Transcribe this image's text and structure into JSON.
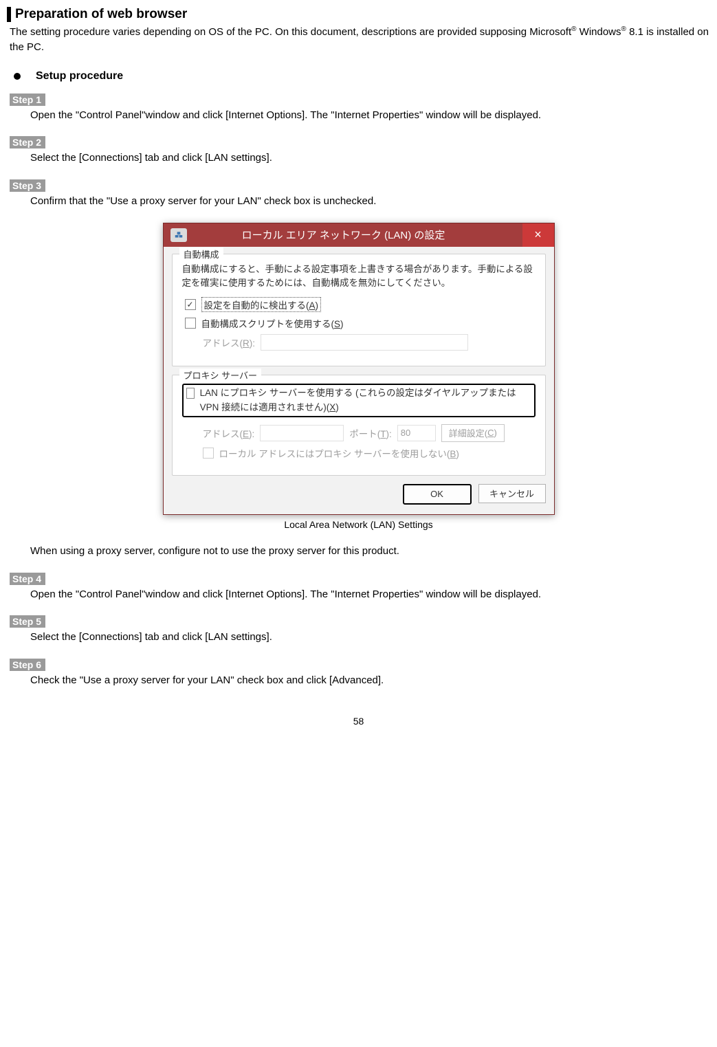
{
  "section": {
    "title": "Preparation of web browser",
    "intro_a": "The setting procedure varies depending on OS of the PC. On this document, descriptions are provided supposing Microsoft",
    "intro_b": " Windows",
    "intro_c": " 8.1 is installed on the PC.",
    "reg": "®"
  },
  "subhead": "Setup procedure",
  "steps": {
    "s1": {
      "tag": "Step 1",
      "body": "Open the \"Control Panel\"window and click [Internet Options]. The \"Internet Properties\" window will be displayed."
    },
    "s2": {
      "tag": "Step 2",
      "body": "Select the [Connections] tab and click [LAN settings]."
    },
    "s3": {
      "tag": "Step 3",
      "body": "Confirm that the \"Use a proxy server for your LAN\" check box is unchecked."
    },
    "s3b": "When using a proxy server, configure not to use the proxy server for this product.",
    "s4": {
      "tag": "Step 4",
      "body": "Open the \"Control Panel\"window and click [Internet Options]. The \"Internet Properties\" window will be displayed."
    },
    "s5": {
      "tag": "Step 5",
      "body": "Select the [Connections] tab and click [LAN settings]."
    },
    "s6": {
      "tag": "Step 6",
      "body": "Check the \"Use a proxy server for your LAN\" check box and click [Advanced]."
    }
  },
  "dialog": {
    "title": "ローカル エリア ネットワーク (LAN) の設定",
    "group_auto": "自動構成",
    "auto_desc": "自動構成にすると、手動による設定事項を上書きする場合があります。手動による設定を確実に使用するためには、自動構成を無効にしてください。",
    "auto_detect_pre": "設定を自動的に検出する(",
    "auto_detect_u": "A",
    "auto_detect_post": ")",
    "auto_script_pre": "自動構成スクリプトを使用する(",
    "auto_script_u": "S",
    "auto_script_post": ")",
    "address_label_pre": "アドレス(",
    "address_label_u": "R",
    "address_label_post": "):",
    "group_proxy": "プロキシ サーバー",
    "proxy_use_pre": "LAN にプロキシ サーバーを使用する (これらの設定はダイヤルアップまたは VPN 接続には適用されません)(",
    "proxy_use_u": "X",
    "proxy_use_post": ")",
    "proxy_addr_pre": "アドレス(",
    "proxy_addr_u": "E",
    "proxy_addr_post": "):",
    "proxy_port_pre": "ポート(",
    "proxy_port_u": "T",
    "proxy_port_post": "):",
    "proxy_port_val": "80",
    "proxy_adv_pre": "詳細設定(",
    "proxy_adv_u": "C",
    "proxy_adv_post": ")",
    "proxy_bypass_pre": "ローカル アドレスにはプロキシ サーバーを使用しない(",
    "proxy_bypass_u": "B",
    "proxy_bypass_post": ")",
    "ok": "OK",
    "cancel": "キャンセル",
    "close": "×"
  },
  "caption": "Local Area Network (LAN) Settings",
  "page": "58"
}
